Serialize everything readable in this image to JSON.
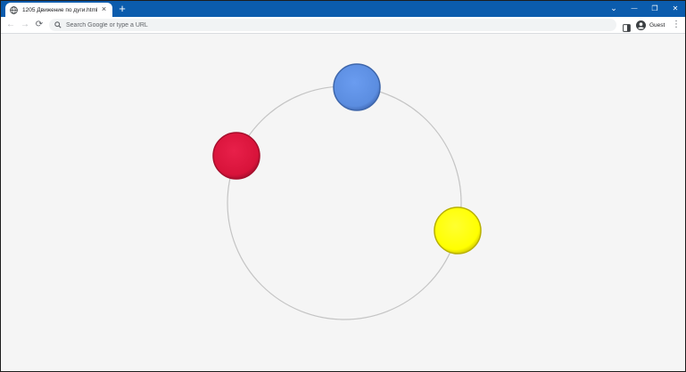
{
  "browser": {
    "tab": {
      "title": "1205 Движение по дуги.html",
      "close_glyph": "×",
      "favicon": "globe-icon"
    },
    "new_tab_glyph": "+",
    "window_controls": {
      "tab_search_glyph": "⌄",
      "minimize_glyph": "—",
      "restore_glyph": "❐",
      "close_glyph": "✕"
    },
    "toolbar": {
      "back_glyph": "←",
      "forward_glyph": "→",
      "reload_glyph": "⟳",
      "omnibox_placeholder": "Search Google or type a URL",
      "profile_name": "Guest",
      "menu_glyph": "⋮"
    },
    "colors": {
      "titlebar": "#0b5cad",
      "page_background": "#f5f5f5"
    }
  },
  "scene": {
    "track_color": "#c4c4c4",
    "balls": [
      {
        "name": "blue",
        "color": "#5b8de0",
        "stroke": "#3e66aa"
      },
      {
        "name": "red",
        "color": "#d8133a",
        "stroke": "#a50f2c"
      },
      {
        "name": "yellow",
        "color": "#ffff00",
        "stroke": "#b8b000"
      }
    ]
  }
}
